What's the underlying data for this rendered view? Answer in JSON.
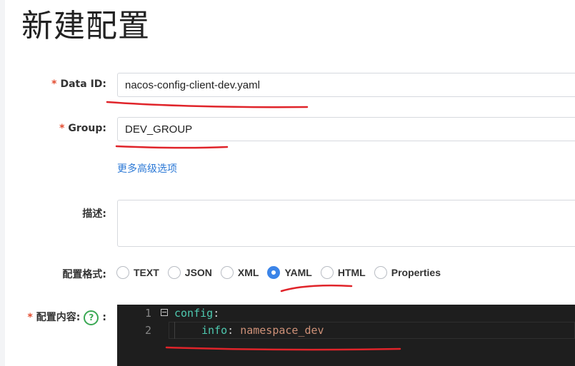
{
  "page": {
    "title": "新建配置"
  },
  "form": {
    "data_id": {
      "label": "Data ID:",
      "required_mark": "*",
      "value": "nacos-config-client-dev.yaml"
    },
    "group": {
      "label": "Group:",
      "required_mark": "*",
      "value": "DEV_GROUP"
    },
    "advanced_link": "更多高级选项",
    "description": {
      "label": "描述:",
      "value": ""
    },
    "format": {
      "label": "配置格式:",
      "selected": "YAML",
      "options": [
        "TEXT",
        "JSON",
        "XML",
        "YAML",
        "HTML",
        "Properties"
      ]
    },
    "content": {
      "label": "配置内容:",
      "required_mark": "*",
      "help_icon_glyph": "?",
      "trailing_colon": ":",
      "lines": [
        {
          "number": "1",
          "key": "config",
          "colon": ":",
          "value": ""
        },
        {
          "number": "2",
          "key": "info",
          "colon": ": ",
          "value": "namespace_dev"
        }
      ]
    }
  },
  "colors": {
    "required": "#e24b2f",
    "link": "#2c79d6",
    "radio_selected": "#3b84e8",
    "editor_bg": "#1e1e1e",
    "code_key": "#4ec9b0",
    "code_value": "#ce9178",
    "annotation": "#e0242a",
    "help_icon": "#3aa853"
  },
  "icons": {
    "help": "question-circle-icon",
    "fold": "fold-minus-icon"
  }
}
